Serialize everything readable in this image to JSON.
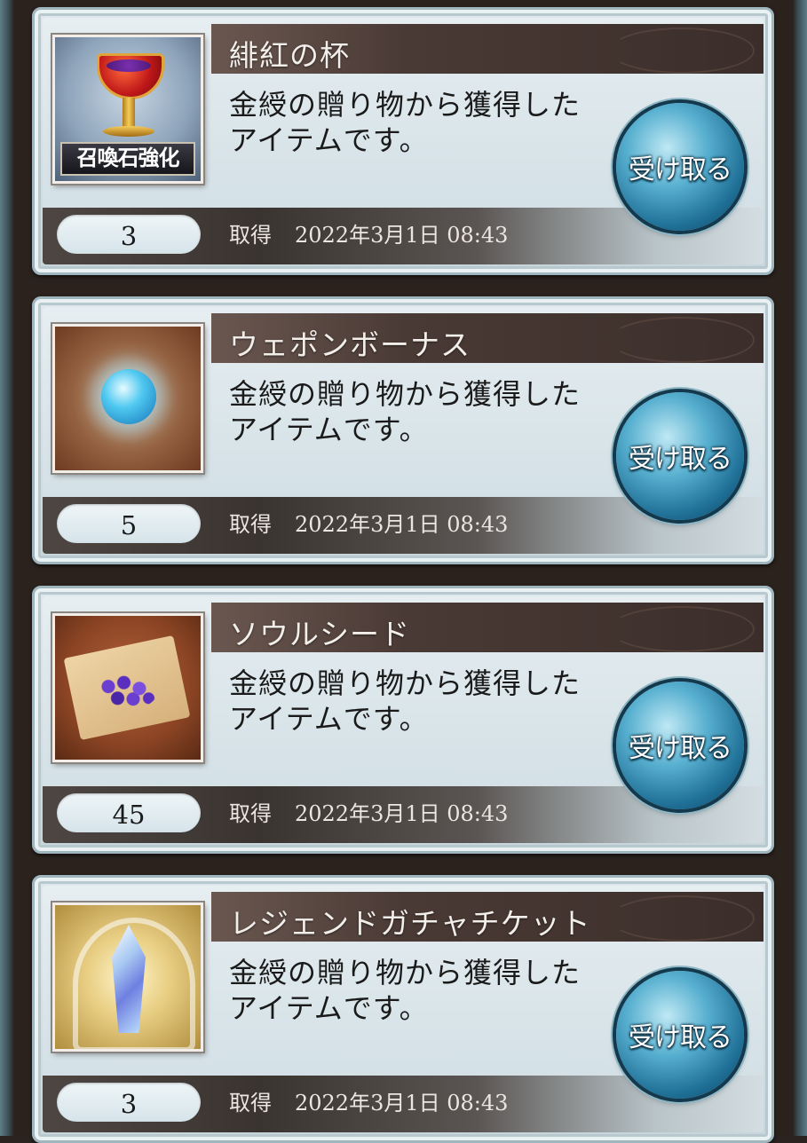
{
  "items": [
    {
      "name": "緋紅の杯",
      "icon": "chalice-icon",
      "icon_badge": "召喚石強化",
      "description_line1": "金綬の贈り物から獲得した",
      "description_line2": "アイテムです。",
      "count": "3",
      "acquired_label": "取得",
      "acquired_date": "2022年3月1日 08:43",
      "button_label": "受け取る"
    },
    {
      "name": "ウェポンボーナス",
      "icon": "blue-orb-icon",
      "description_line1": "金綬の贈り物から獲得した",
      "description_line2": "アイテムです。",
      "count": "5",
      "acquired_label": "取得",
      "acquired_date": "2022年3月1日 08:43",
      "button_label": "受け取る"
    },
    {
      "name": "ソウルシード",
      "icon": "seeds-icon",
      "description_line1": "金綬の贈り物から獲得した",
      "description_line2": "アイテムです。",
      "count": "45",
      "acquired_label": "取得",
      "acquired_date": "2022年3月1日 08:43",
      "button_label": "受け取る"
    },
    {
      "name": "レジェンドガチャチケット",
      "icon": "crystal-ticket-icon",
      "description_line1": "金綬の贈り物から獲得した",
      "description_line2": "アイテムです。",
      "count": "3",
      "acquired_label": "取得",
      "acquired_date": "2022年3月1日 08:43",
      "button_label": "受け取る"
    }
  ],
  "colors": {
    "title_bar": "#4a3a35",
    "card_bg": "#dfe9ed",
    "button": "#1f6f96"
  }
}
